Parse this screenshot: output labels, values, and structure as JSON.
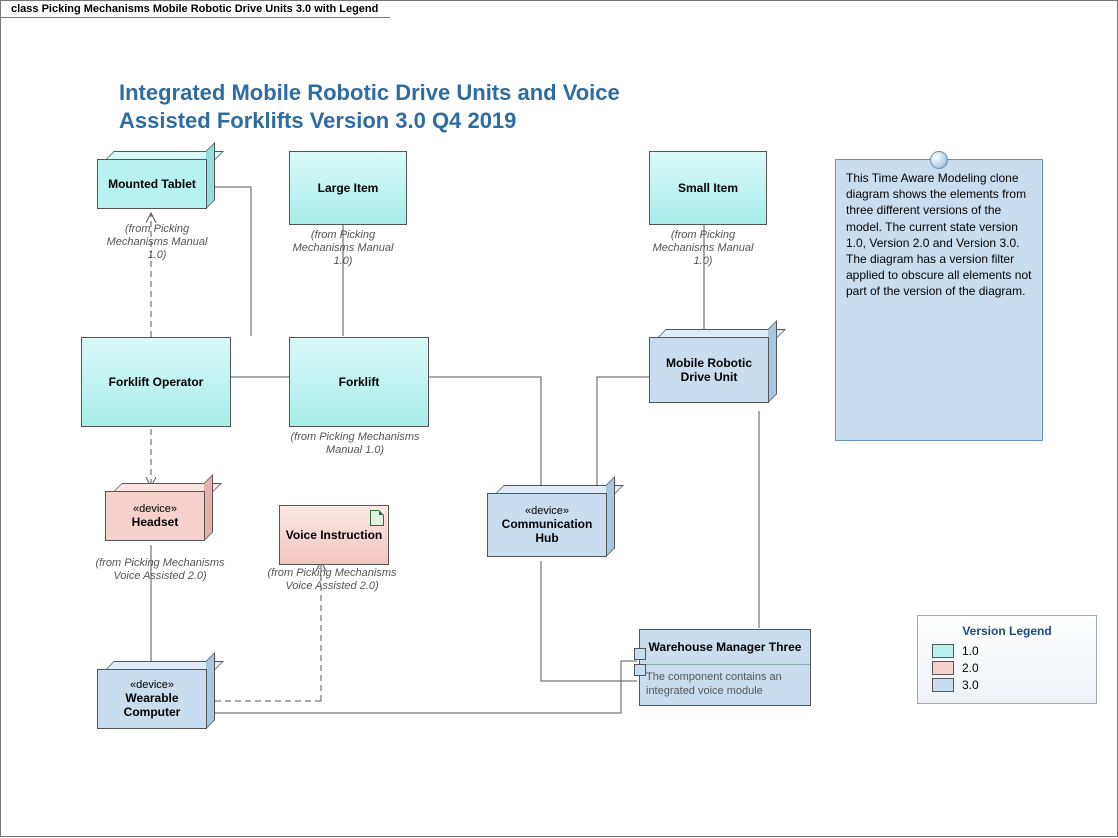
{
  "tab_title": "class Picking Mechanisms Mobile Robotic Drive Units 3.0  with Legend",
  "diagram_title": "Integrated Mobile Robotic Drive Units and Voice Assisted Forklifts Version 3.0 Q4 2019",
  "nodes": {
    "mounted_tablet": {
      "label": "Mounted Tablet",
      "from": "(from Picking Mechanisms Manual 1.0)"
    },
    "large_item": {
      "label": "Large Item",
      "from": "(from Picking Mechanisms Manual 1.0)"
    },
    "small_item": {
      "label": "Small Item",
      "from": "(from Picking Mechanisms Manual 1.0)"
    },
    "forklift_operator": {
      "label": "Forklift Operator"
    },
    "forklift": {
      "label": "Forklift",
      "from": "(from Picking Mechanisms Manual 1.0)"
    },
    "mrdu": {
      "label": "Mobile Robotic Drive Unit"
    },
    "headset": {
      "stereo": "«device»",
      "label": "Headset",
      "from": "(from Picking Mechanisms Voice Assisted 2.0)"
    },
    "voice_instruction": {
      "label": "Voice Instruction",
      "from": "(from Picking Mechanisms Voice Assisted 2.0)"
    },
    "comm_hub": {
      "stereo": "«device»",
      "label": "Communication Hub"
    },
    "wearable": {
      "stereo": "«device»",
      "label": "Wearable Computer"
    },
    "wm3": {
      "label": "Warehouse Manager Three",
      "note": "The component contains an integrated voice module"
    }
  },
  "note_text": "This Time Aware Modeling clone diagram shows the elements from three different versions of the model. The current state version 1.0, Version 2.0 and Version 3.0. The diagram has a version filter applied to obscure all elements not part of the  version of the diagram.",
  "legend": {
    "title": "Version Legend",
    "items": [
      {
        "v": "v10",
        "label": "1.0"
      },
      {
        "v": "v20",
        "label": "2.0"
      },
      {
        "v": "v30",
        "label": "3.0"
      }
    ]
  }
}
